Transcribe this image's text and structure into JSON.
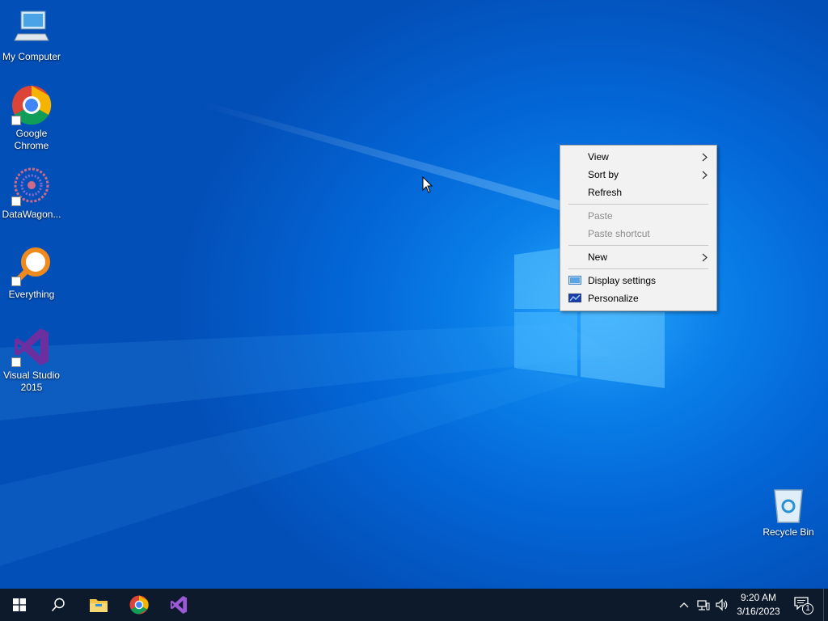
{
  "desktop": {
    "icons": [
      {
        "label": "My Computer"
      },
      {
        "label": "Google Chrome"
      },
      {
        "label": "DataWagon..."
      },
      {
        "label": "Everything"
      },
      {
        "label": "Visual Studio 2015"
      },
      {
        "label": "Recycle Bin"
      }
    ]
  },
  "context_menu": {
    "items": [
      {
        "label": "View",
        "submenu": true
      },
      {
        "label": "Sort by",
        "submenu": true
      },
      {
        "label": "Refresh"
      },
      {
        "label": "Paste",
        "disabled": true
      },
      {
        "label": "Paste shortcut",
        "disabled": true
      },
      {
        "label": "New",
        "submenu": true
      },
      {
        "label": "Display settings",
        "icon": "display-icon"
      },
      {
        "label": "Personalize",
        "icon": "personalize-icon"
      }
    ]
  },
  "taskbar": {
    "pinned": [
      "start-icon",
      "search-icon",
      "file-explorer-icon",
      "chrome-icon",
      "visual-studio-icon"
    ],
    "clock": {
      "time": "9:20 AM",
      "date": "3/16/2023"
    },
    "notification_count": "1"
  },
  "colors": {
    "taskbar": "#0c1a2b",
    "menu_bg": "#f2f2f2",
    "desktop_accent": "#0a7fe8"
  }
}
